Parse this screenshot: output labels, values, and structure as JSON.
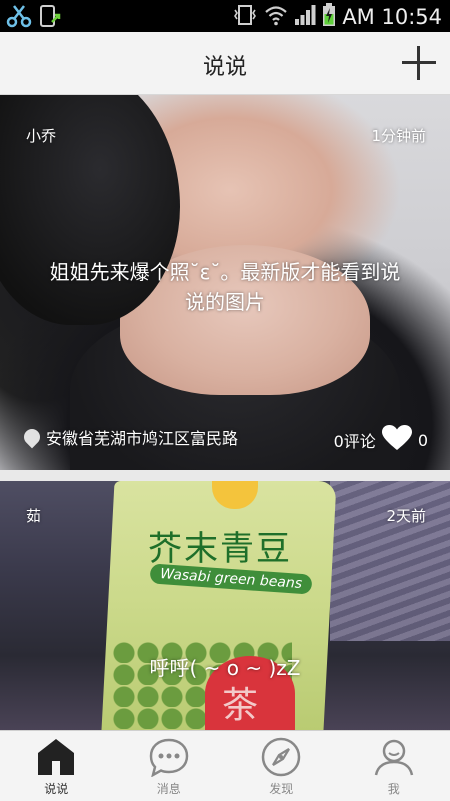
{
  "status_bar": {
    "time": "AM 10:54",
    "icons": [
      "scissors-icon",
      "phone-update-icon",
      "vibrate-icon",
      "wifi-icon",
      "signal-icon",
      "battery-charging-icon"
    ]
  },
  "header": {
    "title": "说说",
    "add_icon": "plus-icon"
  },
  "posts": [
    {
      "author": "小乔",
      "time_ago": "1分钟前",
      "content": "姐姐先来爆个照˘ε˘。最新版才能看到说说的图片",
      "location": "安徽省芜湖市鸠江区富民路",
      "comments": "0评论",
      "likes": "0",
      "location_icon": "location-pin-icon",
      "like_icon": "heart-icon"
    },
    {
      "author": "茹",
      "time_ago": "2天前",
      "content": "呼呼( ~ o ~ )zZ",
      "image_text": {
        "label": "芥末青豆",
        "sublabel": "Wasabi green beans",
        "badge": "茶"
      }
    }
  ],
  "tab_bar": {
    "tabs": [
      {
        "label": "说说",
        "icon": "home-icon",
        "active": true
      },
      {
        "label": "消息",
        "icon": "chat-bubble-icon",
        "active": false
      },
      {
        "label": "发现",
        "icon": "compass-icon",
        "active": false
      },
      {
        "label": "我",
        "icon": "user-icon",
        "active": false
      }
    ]
  }
}
